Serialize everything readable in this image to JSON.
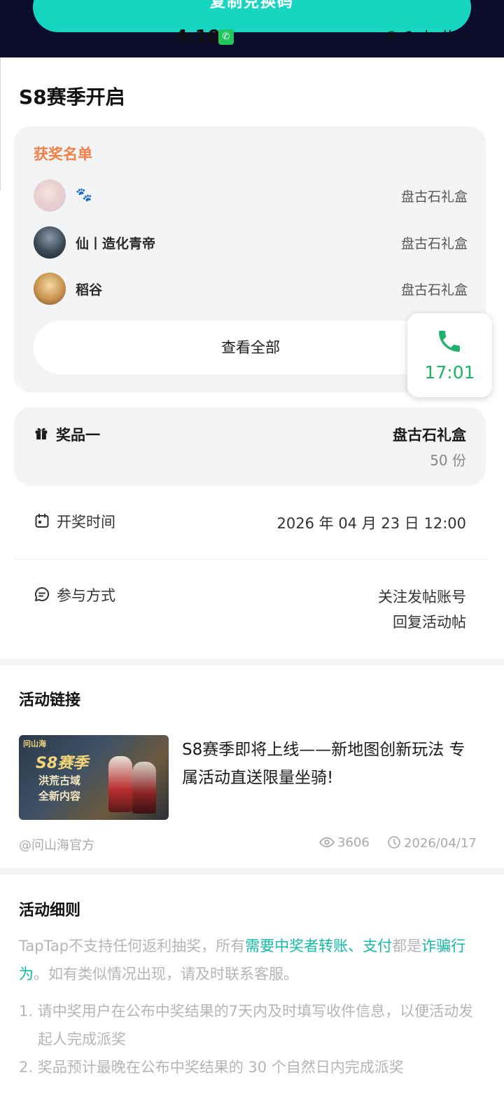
{
  "topbar": {
    "copy_button": "复制兑换码",
    "status_time": "4:10",
    "status_icons": "◉ ⊙ ↓ ıll ▭"
  },
  "page_title": "S8赛季开启",
  "winners": {
    "title": "获奖名单",
    "items": [
      {
        "name": "🐾",
        "prize": "盘古石礼盒"
      },
      {
        "name": "仙丨造化青帝",
        "prize": "盘古石礼盒"
      },
      {
        "name": "稻谷",
        "prize": "盘古石礼盒"
      }
    ],
    "view_all": "查看全部"
  },
  "call_bubble": {
    "time": "17:01",
    "icon": "phone-icon",
    "color": "#20b26a"
  },
  "prize": {
    "label": "奖品一",
    "name": "盘古石礼盒",
    "count": "50 份"
  },
  "draw_time": {
    "label": "开奖时间",
    "value": "2026 年 04 月 23 日 12:00"
  },
  "participation": {
    "label": "参与方式",
    "line1": "关注发帖账号",
    "line2": "回复活动帖"
  },
  "activity_link": {
    "section_title": "活动链接",
    "thumb_logo": "问山海",
    "thumb_title": "S8赛季",
    "thumb_sub1": "洪荒古域",
    "thumb_sub2": "全新内容",
    "text": "S8赛季即将上线——新地图创新玩法 专属活动直送限量坐骑!",
    "author": "@问山海官方",
    "views": "3606",
    "date": "2026/04/17"
  },
  "rules": {
    "section_title": "活动细则",
    "para_prefix": "TapTap不支持任何返利抽奖，所有",
    "para_hl1": "需要中奖者转账、支付",
    "para_mid": "都是",
    "para_hl2": "诈骗行为",
    "para_suffix": "。如有类似情况出现，请及时联系客服。",
    "items": [
      "1. 请中奖用户在公布中奖结果的7天内及时填写收件信息，以便活动发起人完成派奖",
      "2. 奖品预计最晚在公布中奖结果的 30 个自然日内完成派奖"
    ]
  },
  "colors": {
    "accent": "#16d6c2",
    "winners_title": "#f27f45",
    "link_highlight": "#14b8a6",
    "card_bg": "#f3f4f6"
  }
}
